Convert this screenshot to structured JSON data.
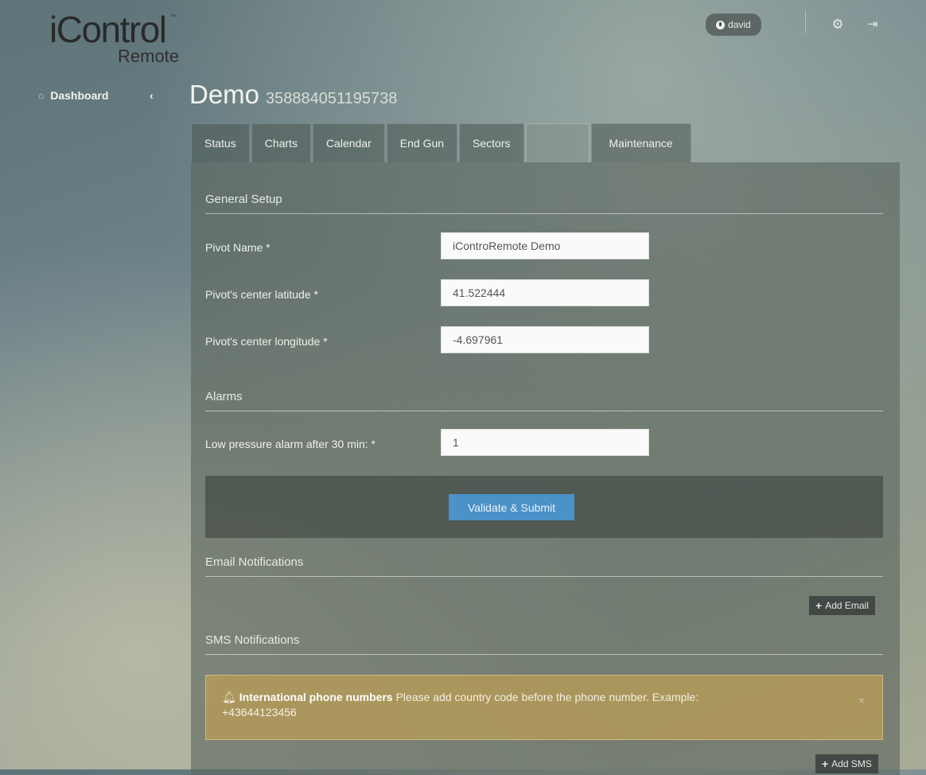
{
  "brand": {
    "logo_main": "iControl",
    "logo_sub": "Remote",
    "tm": "™"
  },
  "header": {
    "user": "david",
    "icons": [
      "user-icon",
      "gear-icon",
      "logout-icon"
    ]
  },
  "breadcrumb": {
    "dashboard": "Dashboard",
    "back_icon": "chevron-left-icon"
  },
  "page": {
    "title": "Demo",
    "serial": "358884051195738"
  },
  "tabs": [
    {
      "label": "Status"
    },
    {
      "label": "Charts"
    },
    {
      "label": "Calendar"
    },
    {
      "label": "End Gun"
    },
    {
      "label": "Sectors"
    },
    {
      "label": ""
    },
    {
      "label": "Maintenance"
    }
  ],
  "general": {
    "title": "General Setup",
    "pivot_name_label": "Pivot Name *",
    "pivot_name_value": "iControRemote Demo",
    "lat_label": "Pivot's center latitude *",
    "lat_value": "41.522444",
    "lon_label": "Pivot's center longitude *",
    "lon_value": "-4.697961"
  },
  "alarms": {
    "title": "Alarms",
    "low_pressure_label": "Low pressure alarm after 30 min: *",
    "low_pressure_value": "1"
  },
  "submit_label": "Validate & Submit",
  "email": {
    "title": "Email Notifications",
    "add_label": "Add Email"
  },
  "sms": {
    "title": "SMS Notifications",
    "alert_strong": "International phone numbers",
    "alert_text": "Please add country code before the phone number. Example:",
    "alert_example": "+43644123456",
    "add_label": "Add SMS"
  },
  "colors": {
    "accent": "#4a92c7",
    "alert": "#bea055",
    "panel": "#5c665e"
  }
}
